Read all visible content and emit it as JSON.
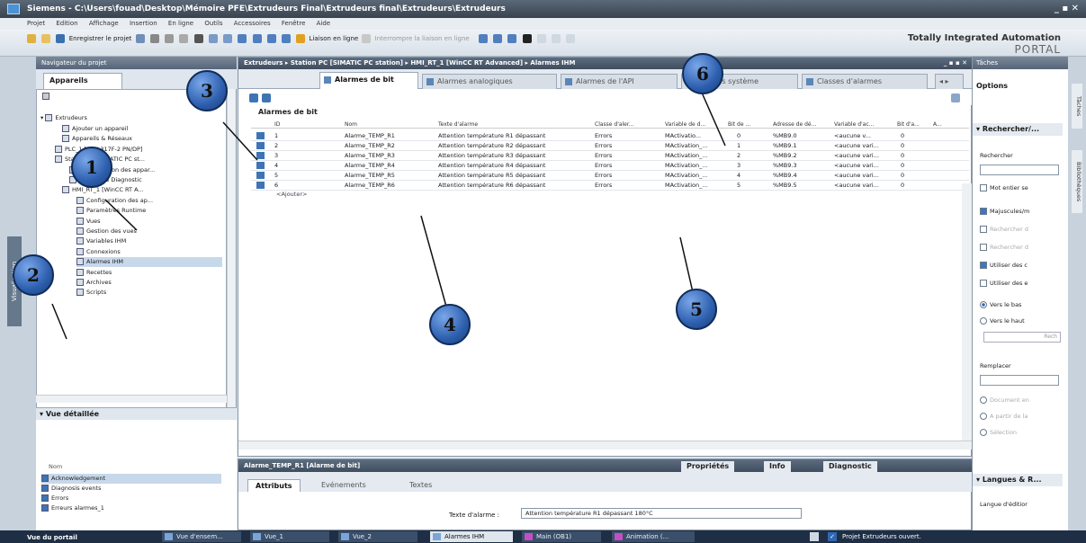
{
  "window": {
    "title": "Siemens - C:\\Users\\fouad\\Desktop\\Mémoire PFE\\Extrudeurs Final\\Extrudeurs final\\Extrudeurs\\Extrudeurs"
  },
  "menu": [
    "Projet",
    "Edition",
    "Affichage",
    "Insertion",
    "En ligne",
    "Outils",
    "Accessoires",
    "Fenêtre",
    "Aide"
  ],
  "toolbar": {
    "save_label": "Enregistrer le projet",
    "online_label": "Liaison en ligne",
    "offline_label": "Interrompre la liaison en ligne"
  },
  "brand": {
    "line1": "Totally Integrated Automation",
    "line2": "PORTAL"
  },
  "vertical_tab": "Visualisation",
  "navigator": {
    "title": "Navigateur du projet",
    "tab": "Appareils",
    "items": [
      {
        "label": "Ajouter un appareil",
        "indent": 28
      },
      {
        "label": "Appareils & Réseaux",
        "indent": 28
      },
      {
        "label": "PLC_1 [CPU 317F-2 PN/DP]",
        "indent": 20
      },
      {
        "label": "Station PC [SIMATIC PC st...",
        "indent": 20
      },
      {
        "label": "Configuration des appar...",
        "indent": 36
      },
      {
        "label": "En ligne & Diagnostic",
        "indent": 36
      },
      {
        "label": "HMI_RT_1 [WinCC RT A...",
        "indent": 28
      },
      {
        "label": "Configuration des ap...",
        "indent": 44
      },
      {
        "label": "Paramètres Runtime",
        "indent": 44
      },
      {
        "label": "Vues",
        "indent": 44
      },
      {
        "label": "Gestion des vues",
        "indent": 44
      },
      {
        "label": "Variables IHM",
        "indent": 44
      },
      {
        "label": "Connexions",
        "indent": 44
      },
      {
        "label": "Alarmes IHM",
        "indent": 44
      },
      {
        "label": "Recettes",
        "indent": 44
      },
      {
        "label": "Archives",
        "indent": 44
      },
      {
        "label": "Scripts",
        "indent": 44
      }
    ],
    "detail_title": "Vue détaillée",
    "detail_col": "Nom",
    "detail_items": [
      "Acknowledgement",
      "Diagnosis events",
      "Errors",
      "Erreurs alarmes_1"
    ]
  },
  "editor": {
    "breadcrumb": "Extrudeurs ▸ Station PC [SIMATIC PC station] ▸ HMI_RT_1 [WinCC RT Advanced] ▸ Alarmes IHM",
    "tabs": [
      "Alarmes de bit",
      "Alarmes analogiques",
      "Alarmes de l'API",
      "Alarmes système",
      "Classes d'alarmes"
    ],
    "section_title": "Alarmes de bit",
    "columns": [
      "ID",
      "Nom",
      "Texte d'alarme",
      "Classe d'aler...",
      "Variable de d...",
      "Bit de ...",
      "Adresse de dé...",
      "Variable d'ac...",
      "Bit d'a...",
      "A..."
    ],
    "rows": [
      {
        "id": "1",
        "name": "Alarme_TEMP_R1",
        "text": "Attention température R1 dépassant",
        "class": "Errors",
        "var": "MActivatio...",
        "bit": "0",
        "addr": "%MB9.0",
        "ack": "<aucune v...",
        "ackbit": "0"
      },
      {
        "id": "2",
        "name": "Alarme_TEMP_R2",
        "text": "Attention température R2 dépassant",
        "class": "Errors",
        "var": "MActivation_...",
        "bit": "1",
        "addr": "%MB9.1",
        "ack": "<aucune vari...",
        "ackbit": "0"
      },
      {
        "id": "3",
        "name": "Alarme_TEMP_R3",
        "text": "Attention température R3 dépassant",
        "class": "Errors",
        "var": "MActivation_...",
        "bit": "2",
        "addr": "%MB9.2",
        "ack": "<aucune vari...",
        "ackbit": "0"
      },
      {
        "id": "4",
        "name": "Alarme_TEMP_R4",
        "text": "Attention température R4 dépassant",
        "class": "Errors",
        "var": "MActivation_...",
        "bit": "3",
        "addr": "%MB9.3",
        "ack": "<aucune vari...",
        "ackbit": "0"
      },
      {
        "id": "5",
        "name": "Alarme_TEMP_R5",
        "text": "Attention température R5 dépassant",
        "class": "Errors",
        "var": "MActivation_...",
        "bit": "4",
        "addr": "%MB9.4",
        "ack": "<aucune vari...",
        "ackbit": "0"
      },
      {
        "id": "6",
        "name": "Alarme_TEMP_R6",
        "text": "Attention température R6 dépassant",
        "class": "Errors",
        "var": "MActivation_...",
        "bit": "5",
        "addr": "%MB9.5",
        "ack": "<aucune vari...",
        "ackbit": "0"
      }
    ],
    "add_row": "<Ajouter>"
  },
  "properties": {
    "header": "Alarme_TEMP_R1 [Alarme de bit]",
    "right_tabs": [
      "Propriétés",
      "Info",
      "Diagnostic"
    ],
    "sub_tabs": [
      "Attributs",
      "Evénements",
      "Textes"
    ],
    "alarm_text_label": "Texte d'alarme :",
    "alarm_text_value": "Attention température R1 dépassant 180°C"
  },
  "tasks": {
    "title": "Tâches",
    "options": "Options",
    "search_title": "Rechercher/...",
    "search_label": "Rechercher",
    "replace_label": "Remplacer",
    "checks": [
      {
        "label": "Mot entier se",
        "on": false
      },
      {
        "label": "Majuscules/m",
        "on": true
      },
      {
        "label": "Rechercher d",
        "on": false
      },
      {
        "label": "Rechercher d",
        "on": false
      },
      {
        "label": "Utiliser des c",
        "on": true
      },
      {
        "label": "Utiliser des e",
        "on": false
      }
    ],
    "radios": [
      {
        "label": "Vers le bas",
        "on": true
      },
      {
        "label": "Vers le haut",
        "on": false
      }
    ],
    "search_btn": "Rech",
    "lower_checks": [
      "Document en",
      "A partir de la",
      "Sélection"
    ],
    "languages": "Langues & R...",
    "lang_label": "Langue d'éditior"
  },
  "right_vtabs": [
    "Tâches",
    "Bibliothèques"
  ],
  "taskbar": {
    "portal": "Vue du portail",
    "items": [
      "Vue d'ensem...",
      "Vue_1",
      "Vue_2",
      "Alarmes IHM",
      "Main (OB1)",
      "Animation (..."
    ],
    "status": "Projet Extrudeurs ouvert."
  },
  "callouts": [
    "1",
    "2",
    "3",
    "4",
    "5",
    "6"
  ]
}
